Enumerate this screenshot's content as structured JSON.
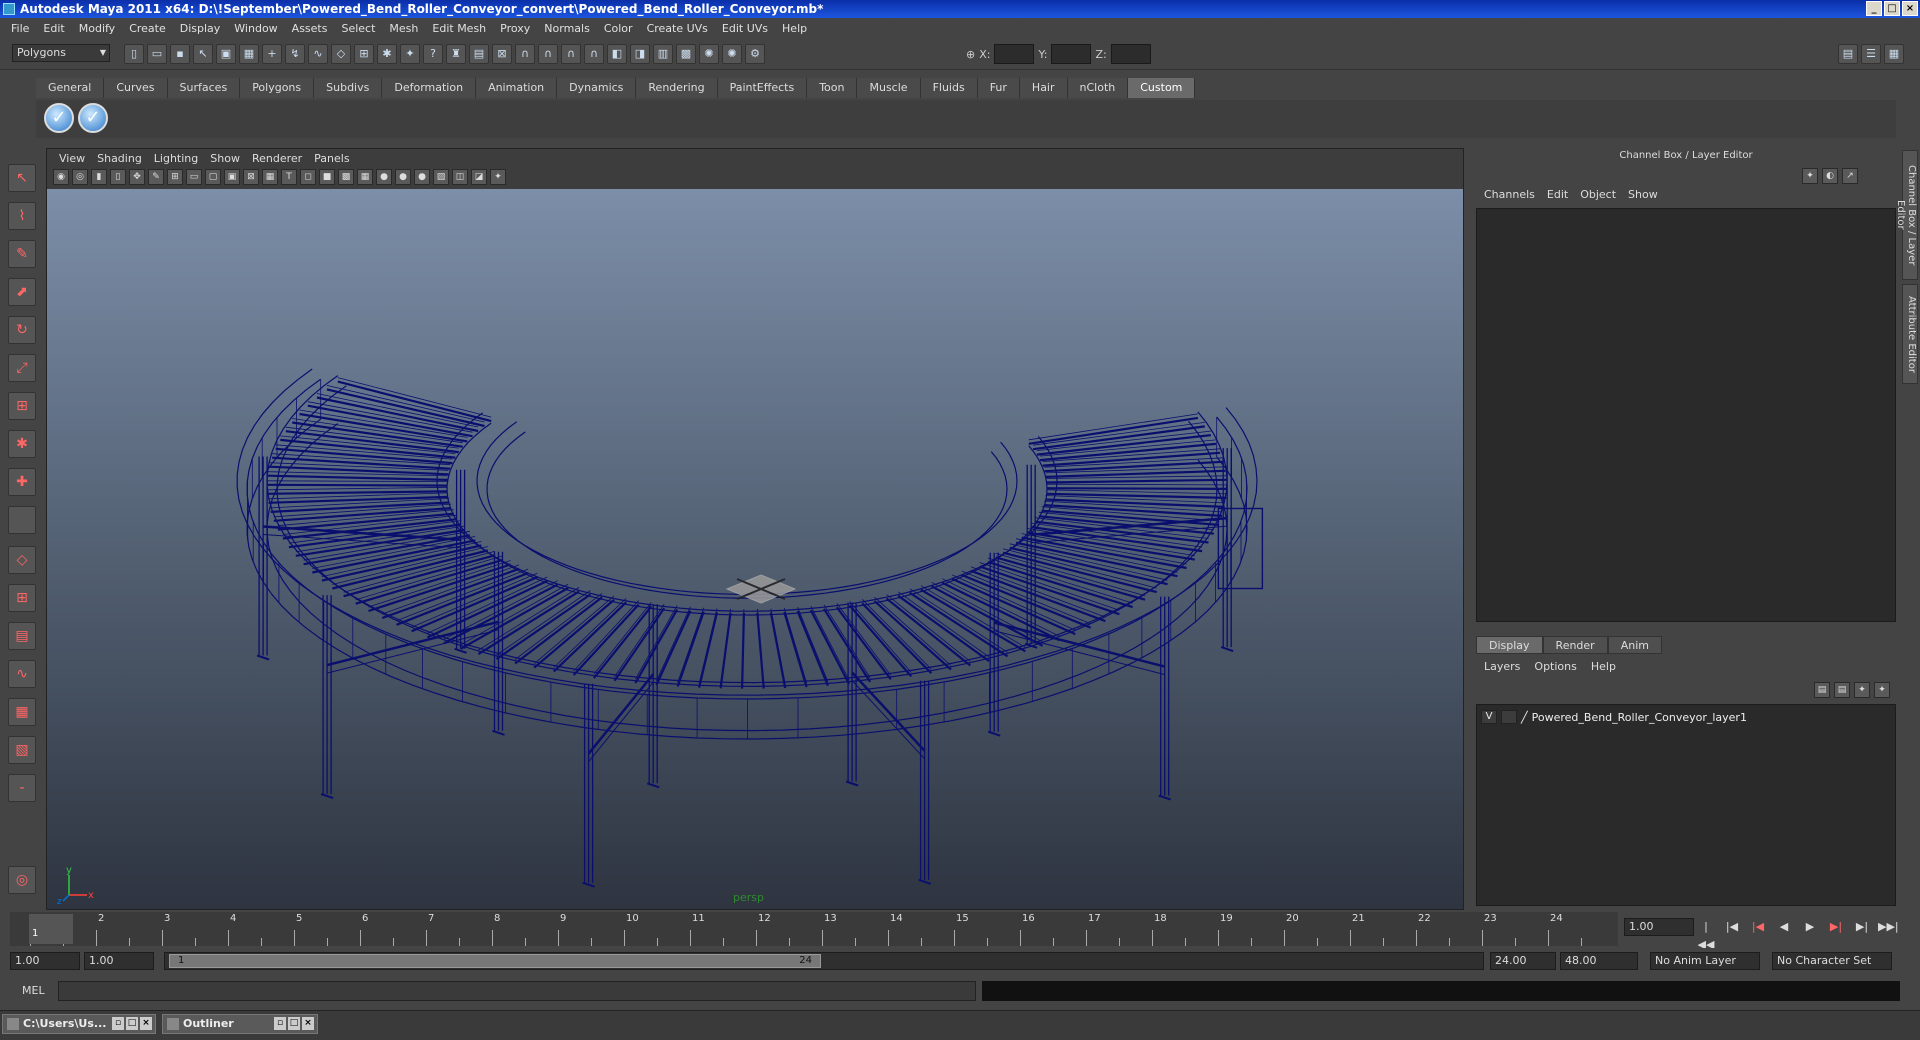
{
  "window": {
    "title": "Autodesk Maya 2011 x64: D:\\!September\\Powered_Bend_Roller_Conveyor_convert\\Powered_Bend_Roller_Conveyor.mb*",
    "min": "_",
    "max": "□",
    "close": "×"
  },
  "menubar": [
    "File",
    "Edit",
    "Modify",
    "Create",
    "Display",
    "Window",
    "Assets",
    "Select",
    "Mesh",
    "Edit Mesh",
    "Proxy",
    "Normals",
    "Color",
    "Create UVs",
    "Edit UVs",
    "Help"
  ],
  "statusline": {
    "mode": "Polygons",
    "x_label": "X:",
    "y_label": "Y:",
    "z_label": "Z:"
  },
  "shelf": {
    "tabs": [
      "General",
      "Curves",
      "Surfaces",
      "Polygons",
      "Subdivs",
      "Deformation",
      "Animation",
      "Dynamics",
      "Rendering",
      "PaintEffects",
      "Toon",
      "Muscle",
      "Fluids",
      "Fur",
      "Hair",
      "nCloth",
      "Custom"
    ],
    "active": "Custom"
  },
  "viewport": {
    "menu": [
      "View",
      "Shading",
      "Lighting",
      "Show",
      "Renderer",
      "Panels"
    ],
    "camera": "persp",
    "axis_x": "x",
    "axis_y": "y",
    "axis_z": "z",
    "wire_color": "#0a0f6e"
  },
  "channelbox": {
    "title": "Channel Box / Layer Editor",
    "menu": [
      "Channels",
      "Edit",
      "Object",
      "Show"
    ],
    "side_tabs": [
      "Channel Box / Layer Editor",
      "Attribute Editor"
    ]
  },
  "layers": {
    "tabs": [
      "Display",
      "Render",
      "Anim"
    ],
    "active": "Display",
    "menu": [
      "Layers",
      "Options",
      "Help"
    ],
    "rows": [
      {
        "visible": "V",
        "name": "Powered_Bend_Roller_Conveyor_layer1"
      }
    ]
  },
  "timeline": {
    "ticks": [
      "1",
      "2",
      "3",
      "4",
      "5",
      "6",
      "7",
      "8",
      "9",
      "10",
      "11",
      "12",
      "13",
      "14",
      "15",
      "16",
      "17",
      "18",
      "19",
      "20",
      "21",
      "22",
      "23",
      "24"
    ],
    "current_frame": "1.00",
    "current_marker": "1"
  },
  "range": {
    "start": "1.00",
    "playback_start": "1.00",
    "handle_start": "1",
    "handle_end": "24",
    "playback_end": "24.00",
    "end": "48.00",
    "anim_layer": "No Anim Layer",
    "char_set": "No Character Set"
  },
  "cmdline": {
    "label": "MEL"
  },
  "taskbar": [
    {
      "label": "C:\\Users\\Us..."
    },
    {
      "label": "Outliner"
    }
  ]
}
